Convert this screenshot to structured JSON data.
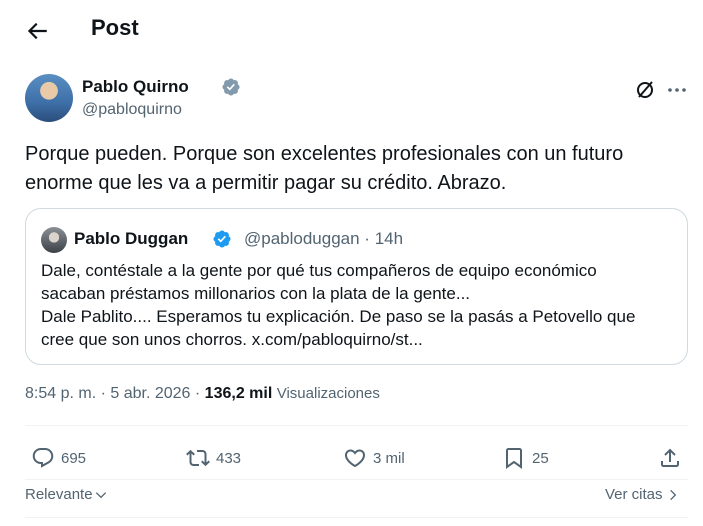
{
  "header": {
    "title": "Post",
    "back_icon": "arrow-left-icon"
  },
  "post": {
    "author": {
      "name": "Pablo Quirno",
      "handle": "@pabloquirno",
      "verified": true
    },
    "text": "Porque pueden. Porque son excelentes profesionales con un futuro enorme que les va a permitir pagar su crédito. Abrazo.",
    "quote": {
      "author": {
        "name": "Pablo Duggan",
        "handle_time": "@pabloduggan · 14h",
        "verified": true
      },
      "lines": [
        "Dale, contéstale a la gente por qué tus compañeros de equipo económico",
        "sacaban préstamos millonarios con la plata de la gente...",
        "Dale Pablito.... Esperamos tu explicación. De paso se la pasás a Petovello que",
        "cree que son unos chorros. x.com/pabloquirno/st..."
      ]
    },
    "meta": {
      "time": "8:54 p. m.",
      "sep1": " · ",
      "date": "5 abr. 2026",
      "sep2": " · ",
      "views": "136,2 mil",
      "views_label": "Visualizaciones"
    },
    "actions": {
      "replies": "695",
      "reposts": "433",
      "likes": "3 mil",
      "bookmarks": "25"
    }
  },
  "footer": {
    "sort_label": "Relevante",
    "quotes_label": "Ver citas"
  },
  "colors": {
    "text": "#0f1419",
    "secondary": "#536471",
    "verified": "#1d9bf0",
    "border": "#cfd9de"
  }
}
